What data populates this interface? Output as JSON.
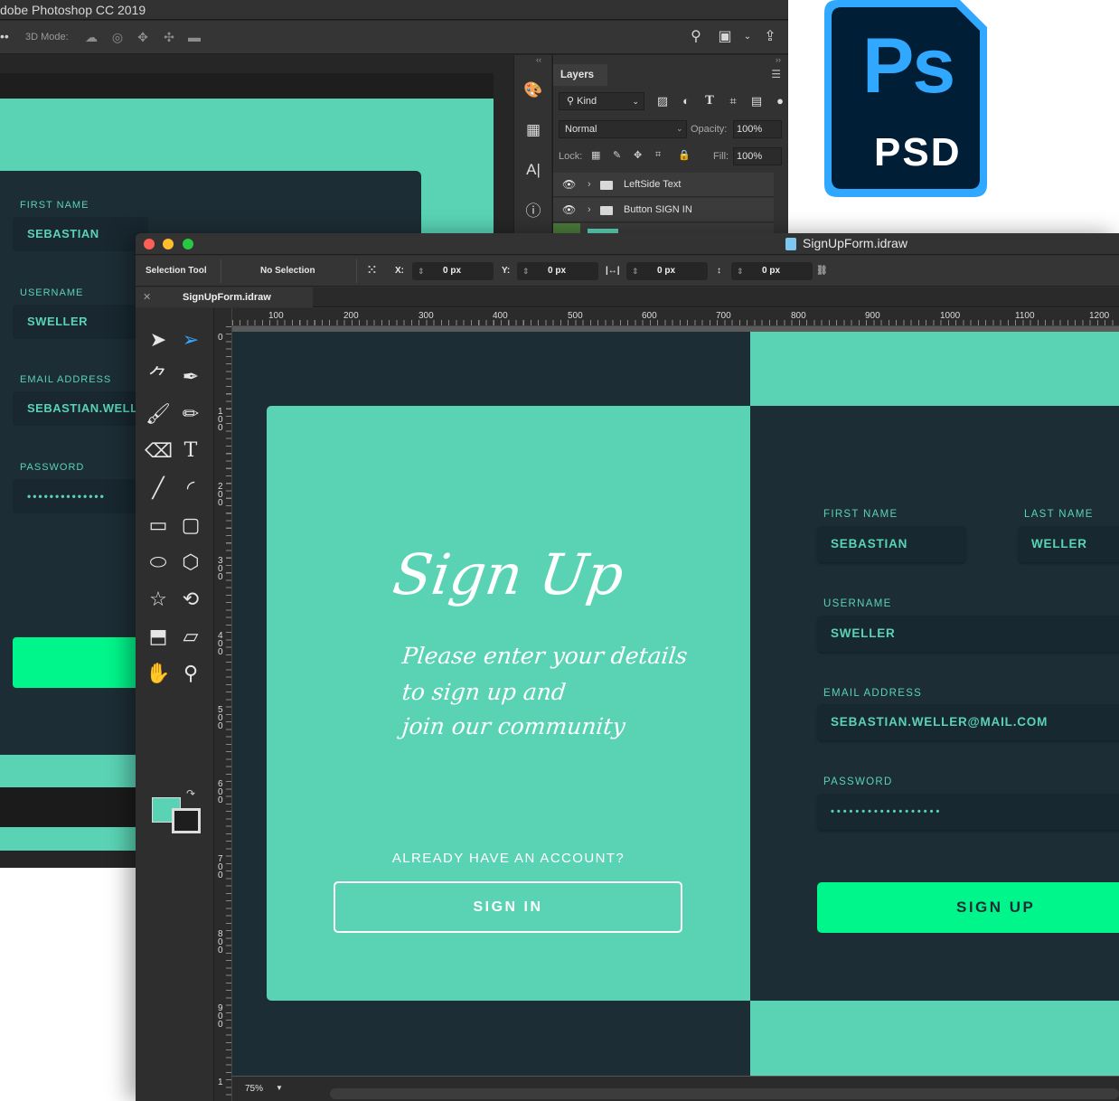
{
  "photoshop": {
    "title": "dobe Photoshop CC 2019",
    "options_bar": {
      "mode_label": "3D Mode:"
    },
    "layers_panel": {
      "tab_label": "Layers",
      "kind_filter": "Kind",
      "blend_mode": "Normal",
      "opacity_label": "Opacity:",
      "opacity_value": "100%",
      "lock_label": "Lock:",
      "fill_label": "Fill:",
      "fill_value": "100%",
      "layers": [
        {
          "name": "LeftSide Text"
        },
        {
          "name": "Button SIGN IN"
        }
      ]
    },
    "canvas_form": {
      "first_name_label": "FIRST NAME",
      "first_name_value": "SEBASTIAN",
      "username_label": "USERNAME",
      "username_value": "SWELLER",
      "email_label": "EMAIL ADDRESS",
      "email_value": "SEBASTIAN.WELLE",
      "password_label": "PASSWORD",
      "password_value": "••••••••••••••"
    }
  },
  "ps_icon": {
    "logo_text": "Ps",
    "format_label": "PSD",
    "color_border": "#31a8ff",
    "color_bg": "#001e36"
  },
  "idraw": {
    "window_title": "SignUpForm.idraw",
    "info_bar": {
      "tool": "Selection Tool",
      "selection": "No Selection",
      "x_label": "X:",
      "x_value": "0 px",
      "y_label": "Y:",
      "y_value": "0 px",
      "w_value": "0 px",
      "h_value": "0 px"
    },
    "tab_label": "SignUpForm.idraw",
    "ruler_h": [
      "100",
      "200",
      "300",
      "400",
      "500",
      "600",
      "700",
      "800",
      "900",
      "1000",
      "1100",
      "1200"
    ],
    "ruler_v": [
      "0",
      "100",
      "200",
      "300",
      "400",
      "500",
      "600",
      "700",
      "800",
      "900",
      "1"
    ],
    "zoom": "75%",
    "tools": [
      "arrow-icon",
      "direct-select-icon",
      "node-icon",
      "pen-icon",
      "brush-icon",
      "pencil-icon",
      "eraser-icon",
      "text-icon",
      "line-icon",
      "arc-icon",
      "rectangle-icon",
      "rounded-rect-icon",
      "ellipse-icon",
      "polygon-icon",
      "star-icon",
      "spiral-icon",
      "crop-icon",
      "skew-icon",
      "hand-icon",
      "zoom-icon"
    ],
    "fill_color": "#5ad3b4"
  },
  "design": {
    "colors": {
      "teal": "#5ad3b4",
      "dark": "#1d2d35",
      "green": "#00f58a"
    },
    "title": "Sign Up",
    "subtitle_lines": [
      "Please enter your details",
      "to sign up and",
      "join our community"
    ],
    "already_text": "ALREADY HAVE AN ACCOUNT?",
    "sign_in_label": "SIGN IN",
    "first_name_label": "FIRST NAME",
    "first_name_value": "SEBASTIAN",
    "last_name_label": "LAST NAME",
    "last_name_value": "WELLER",
    "username_label": "USERNAME",
    "username_value": "SWELLER",
    "email_label": "EMAIL ADDRESS",
    "email_value": "SEBASTIAN.WELLER@MAIL.COM",
    "password_label": "PASSWORD",
    "password_value": "••••••••••••••••••",
    "sign_up_label": "SIGN UP"
  }
}
